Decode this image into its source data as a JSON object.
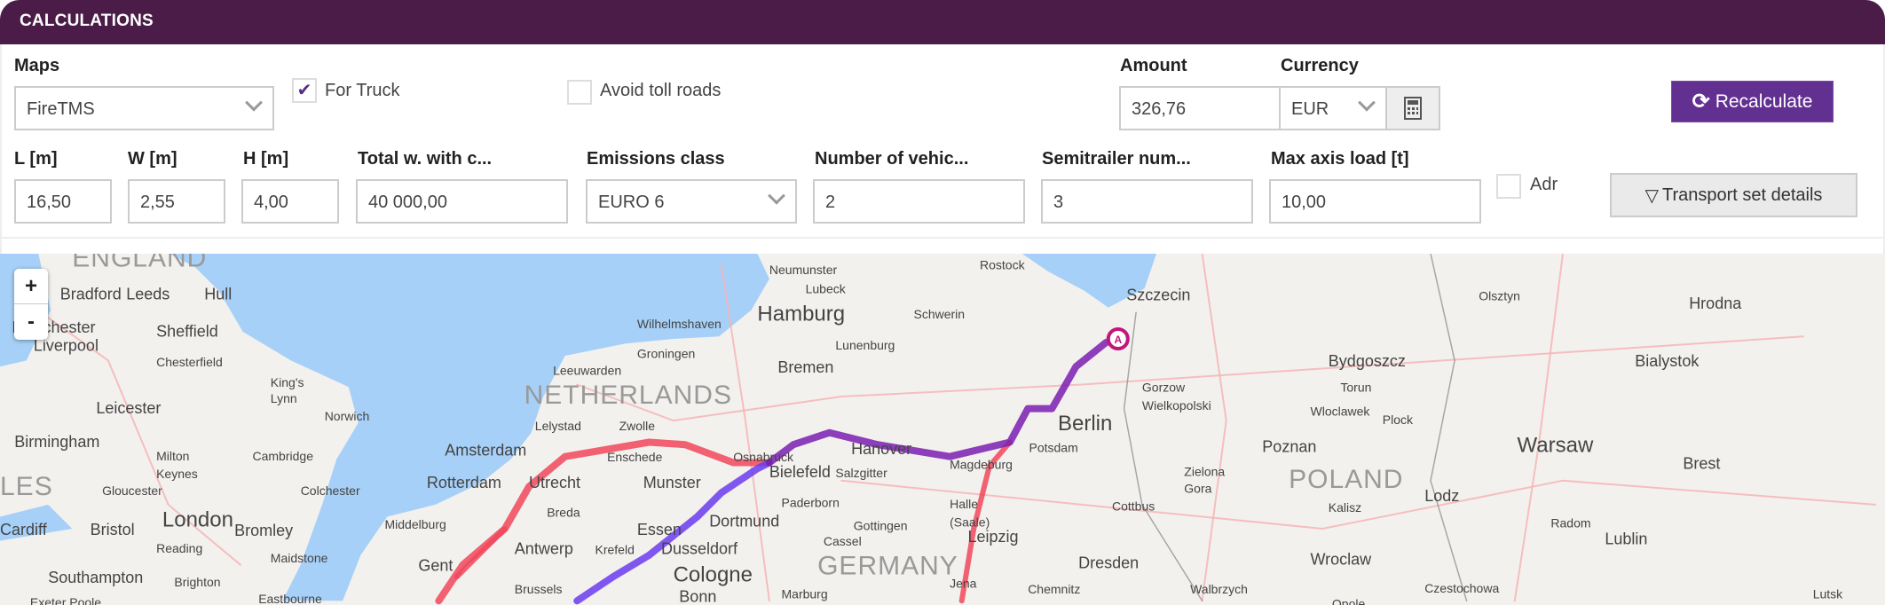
{
  "header": {
    "title": "CALCULATIONS"
  },
  "colors": {
    "header": "#4a1c47",
    "accent": "#623091",
    "route_red": "#f0485a",
    "route_purple": "#7a1fb0",
    "route_blue": "#6a3cf0",
    "sea": "#a6d0f7",
    "land": "#f3f1ee"
  },
  "form": {
    "maps": {
      "label": "Maps",
      "value": "FireTMS"
    },
    "for_truck": {
      "label": "For Truck",
      "checked": true
    },
    "avoid_toll": {
      "label": "Avoid toll roads",
      "checked": false
    },
    "amount": {
      "label": "Amount",
      "value": "326,76"
    },
    "currency": {
      "label": "Currency",
      "value": "EUR"
    },
    "recalculate": "Recalculate",
    "length": {
      "label": "L [m]",
      "value": "16,50"
    },
    "width": {
      "label": "W [m]",
      "value": "2,55"
    },
    "height": {
      "label": "H [m]",
      "value": "4,00"
    },
    "total_weight": {
      "label": "Total w. with c...",
      "value": "40 000,00"
    },
    "emissions": {
      "label": "Emissions class",
      "value": "EURO 6"
    },
    "vehicles": {
      "label": "Number of vehic...",
      "value": "2"
    },
    "semitrailer": {
      "label": "Semitrailer num...",
      "value": "3"
    },
    "max_axis": {
      "label": "Max axis load [t]",
      "value": "10,00"
    },
    "adr": {
      "label": "Adr",
      "checked": false
    },
    "transport_details": "Transport set details"
  },
  "map": {
    "zoom_in": "+",
    "zoom_out": "-",
    "marker": "A",
    "labels": [
      "ENGLAND",
      "Bradford",
      "Leeds",
      "Hull",
      "Manchester",
      "Sheffield",
      "Liverpool",
      "Chesterfield",
      "King's",
      "Lynn",
      "Leicester",
      "Norwich",
      "Birmingham",
      "Milton",
      "Keynes",
      "Cambridge",
      "LES",
      "Gloucester",
      "Colchester",
      "London",
      "Bromley",
      "Cardiff",
      "Bristol",
      "Reading",
      "Maidstone",
      "Southampton",
      "Brighton",
      "Eastbourne",
      "Exeter Poole",
      "Neumunster",
      "Lubeck",
      "Hamburg",
      "Wilhelmshaven",
      "Lunenburg",
      "Groningen",
      "Bremen",
      "Leeuwarden",
      "NETHERLANDS",
      "Lelystad",
      "Zwolle",
      "Amsterdam",
      "Enschede",
      "Osnabruck",
      "Hanover",
      "Rotterdam",
      "Utrecht",
      "Munster",
      "Bielefeld",
      "Salzgitter",
      "Paderborn",
      "Middelburg",
      "Breda",
      "Essen",
      "Dortmund",
      "Gottingen",
      "Antwerp",
      "Krefeld",
      "Dusseldorf",
      "Cassel",
      "Gent",
      "Cologne",
      "GERMANY",
      "Brussels",
      "Bonn",
      "Marburg",
      "Rostock",
      "Schwerin",
      "Szczecin",
      "Bydgoszcz",
      "Olsztyn",
      "Hrodna",
      "Bialystok",
      "Gorzow",
      "Wielkopolski",
      "Torun",
      "Wloclawek",
      "Plock",
      "Berlin",
      "Potsdam",
      "Poznan",
      "Warsaw",
      "Magdeburg",
      "Zielona",
      "Gora",
      "POLAND",
      "Brest",
      "Halle",
      "(Saale)",
      "Cottbus",
      "Kalisz",
      "Lodz",
      "Leipzig",
      "Radom",
      "Lublin",
      "Dresden",
      "Wroclaw",
      "Chemnitz",
      "Walbrzych",
      "Czestochowa",
      "Jena",
      "Opole",
      "Lutsk"
    ]
  }
}
